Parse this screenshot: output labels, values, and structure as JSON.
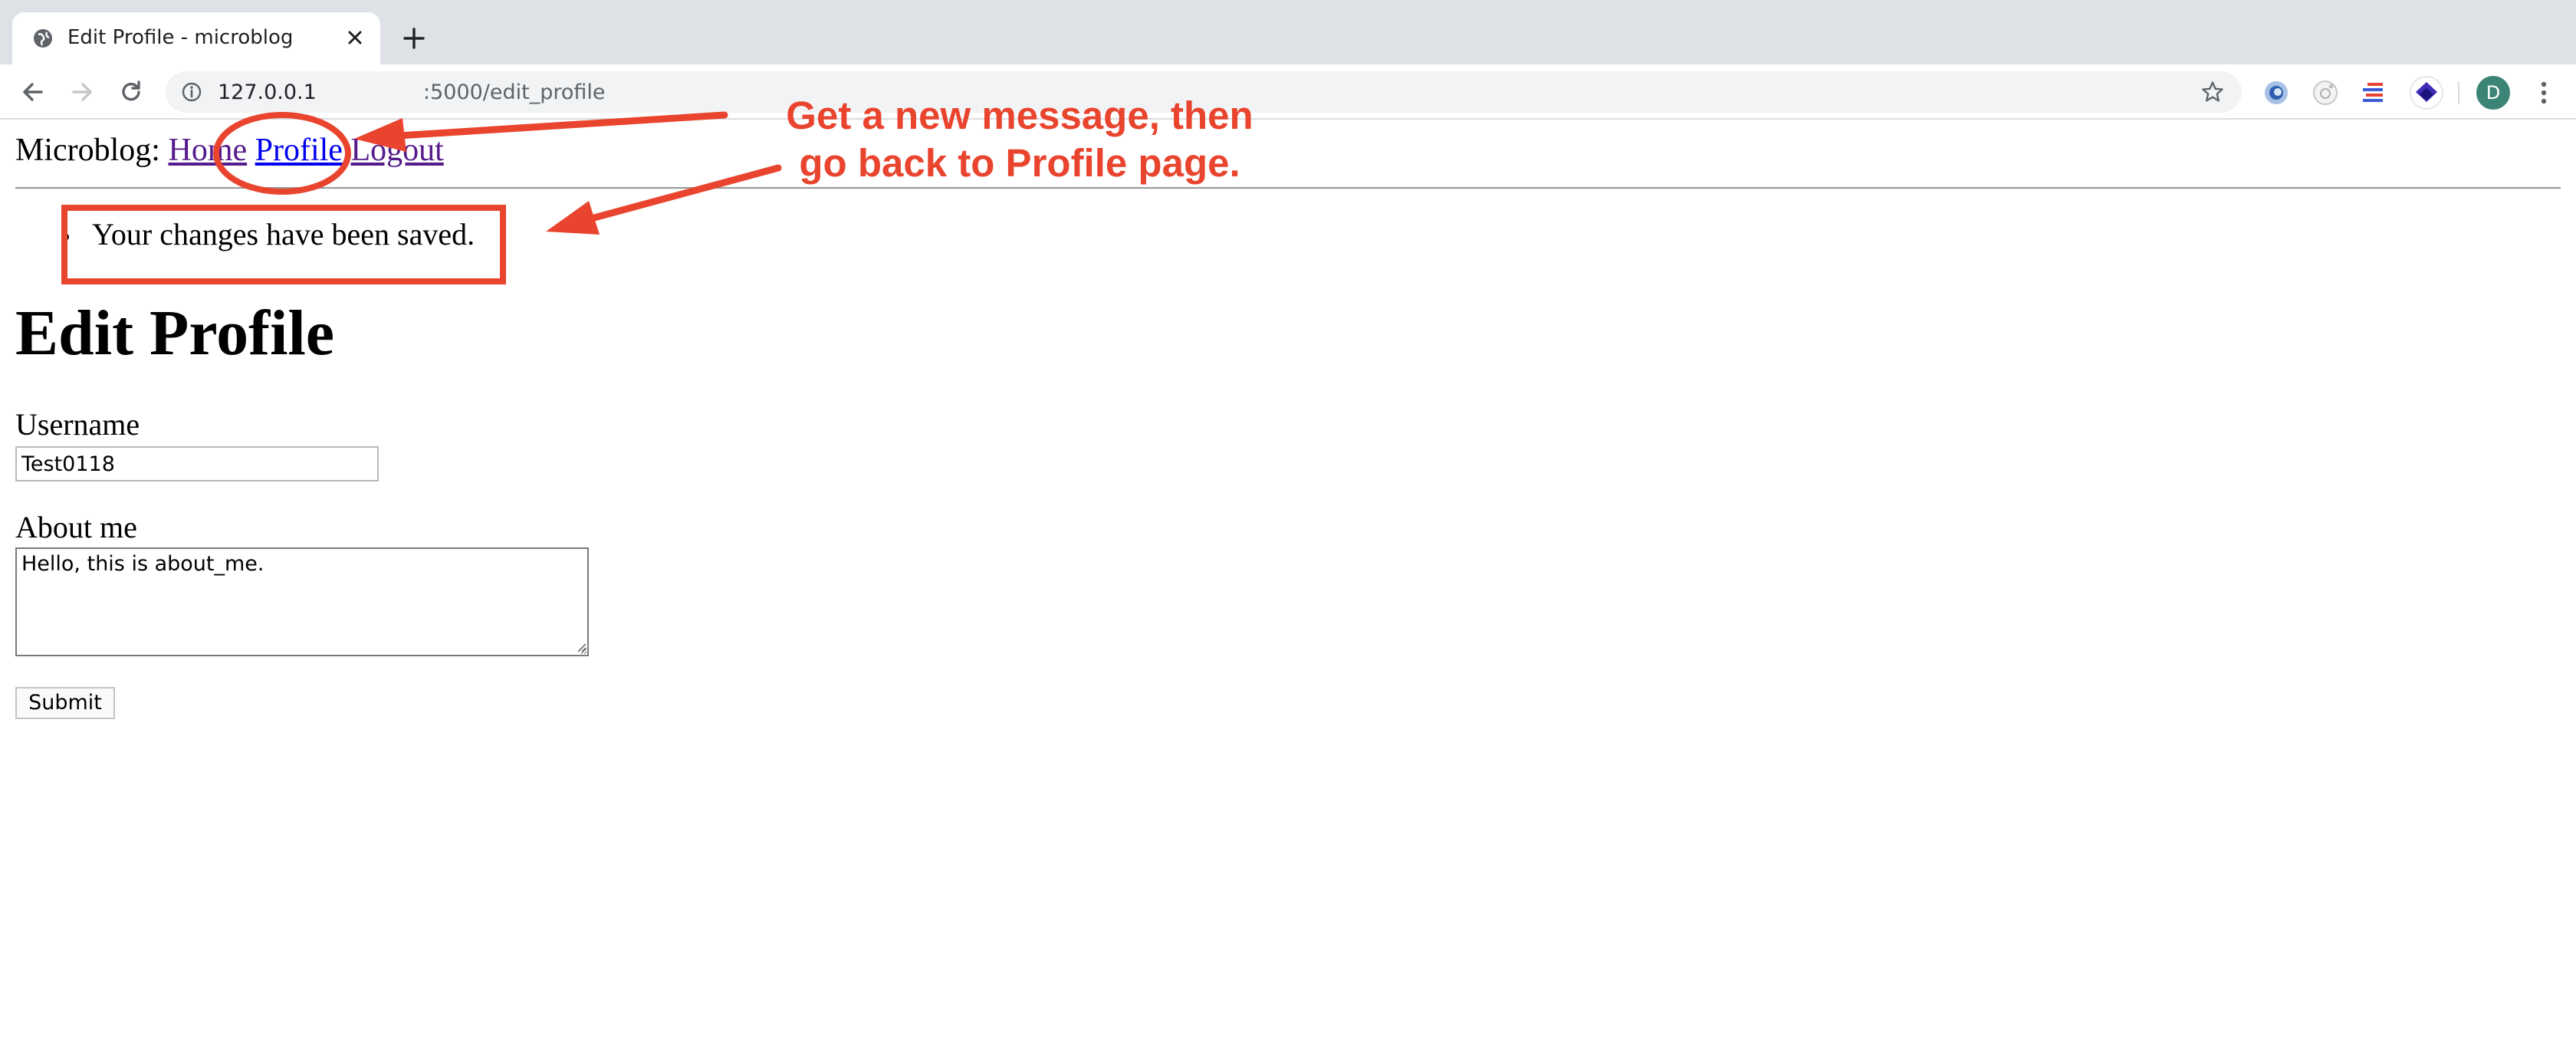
{
  "browser": {
    "tab": {
      "title": "Edit Profile - microblog",
      "globe_icon": "globe-icon",
      "close_icon": "close-icon"
    },
    "new_tab_icon": "plus-icon",
    "nav": {
      "back_icon": "back-arrow-icon",
      "forward_icon": "forward-arrow-icon",
      "reload_icon": "reload-icon"
    },
    "address_bar": {
      "host": "127.0.0.1",
      "path": ":5000/edit_profile",
      "info_icon": "info-icon",
      "bookmark_icon": "star-icon"
    },
    "extensions": [
      "extension-1-icon",
      "extension-2-icon",
      "extension-3-icon",
      "extension-4-icon"
    ],
    "profile_avatar": "D",
    "menu_icon": "kebab-menu-icon"
  },
  "page": {
    "nav": {
      "brand": "Microblog:",
      "links": [
        {
          "label": "Home"
        },
        {
          "label": "Profile"
        },
        {
          "label": "Logout"
        }
      ]
    },
    "flash_messages": [
      "Your changes have been saved."
    ],
    "title": "Edit Profile",
    "form": {
      "username_label": "Username",
      "username_value": "Test0118",
      "about_label": "About me",
      "about_value": "Hello, this is about_me.",
      "submit_label": "Submit"
    }
  },
  "annotation": {
    "line1": "Get a new message, then",
    "line2": "go back to Profile page.",
    "color": "#e9442e"
  },
  "colors": {
    "tabbar": "#dee1e6",
    "link": "#0000ee",
    "visited_link": "#551a8b",
    "avatar": "#3c8576"
  }
}
